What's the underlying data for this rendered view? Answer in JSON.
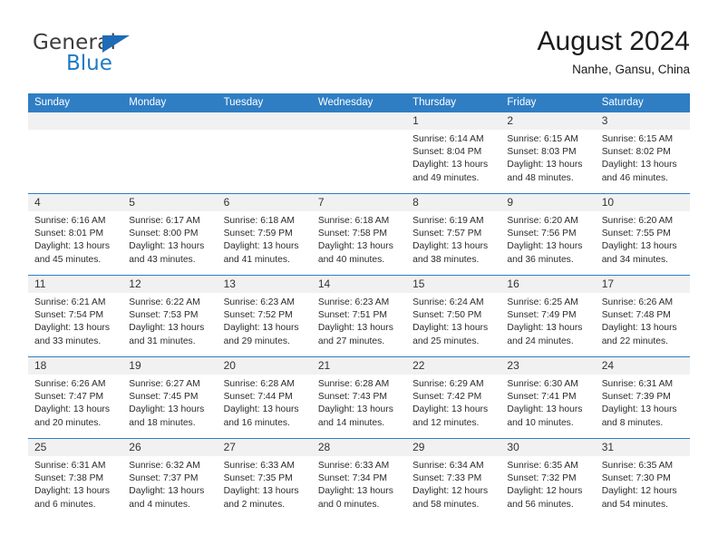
{
  "brand": {
    "name_part1": "General",
    "name_part2": "Blue",
    "flag_icon": "triangle-flag-icon"
  },
  "header": {
    "title": "August 2024",
    "subtitle": "Nanhe, Gansu, China"
  },
  "weekdays": [
    "Sunday",
    "Monday",
    "Tuesday",
    "Wednesday",
    "Thursday",
    "Friday",
    "Saturday"
  ],
  "colors": {
    "header_blue": "#2f7ec4",
    "brand_blue": "#1f7ac4",
    "day_strip_gray": "#f1f1f1",
    "text": "#2b2b2b"
  },
  "weeks": [
    [
      {
        "day": "",
        "lines": []
      },
      {
        "day": "",
        "lines": []
      },
      {
        "day": "",
        "lines": []
      },
      {
        "day": "",
        "lines": []
      },
      {
        "day": "1",
        "lines": [
          "Sunrise: 6:14 AM",
          "Sunset: 8:04 PM",
          "Daylight: 13 hours",
          "and 49 minutes."
        ]
      },
      {
        "day": "2",
        "lines": [
          "Sunrise: 6:15 AM",
          "Sunset: 8:03 PM",
          "Daylight: 13 hours",
          "and 48 minutes."
        ]
      },
      {
        "day": "3",
        "lines": [
          "Sunrise: 6:15 AM",
          "Sunset: 8:02 PM",
          "Daylight: 13 hours",
          "and 46 minutes."
        ]
      }
    ],
    [
      {
        "day": "4",
        "lines": [
          "Sunrise: 6:16 AM",
          "Sunset: 8:01 PM",
          "Daylight: 13 hours",
          "and 45 minutes."
        ]
      },
      {
        "day": "5",
        "lines": [
          "Sunrise: 6:17 AM",
          "Sunset: 8:00 PM",
          "Daylight: 13 hours",
          "and 43 minutes."
        ]
      },
      {
        "day": "6",
        "lines": [
          "Sunrise: 6:18 AM",
          "Sunset: 7:59 PM",
          "Daylight: 13 hours",
          "and 41 minutes."
        ]
      },
      {
        "day": "7",
        "lines": [
          "Sunrise: 6:18 AM",
          "Sunset: 7:58 PM",
          "Daylight: 13 hours",
          "and 40 minutes."
        ]
      },
      {
        "day": "8",
        "lines": [
          "Sunrise: 6:19 AM",
          "Sunset: 7:57 PM",
          "Daylight: 13 hours",
          "and 38 minutes."
        ]
      },
      {
        "day": "9",
        "lines": [
          "Sunrise: 6:20 AM",
          "Sunset: 7:56 PM",
          "Daylight: 13 hours",
          "and 36 minutes."
        ]
      },
      {
        "day": "10",
        "lines": [
          "Sunrise: 6:20 AM",
          "Sunset: 7:55 PM",
          "Daylight: 13 hours",
          "and 34 minutes."
        ]
      }
    ],
    [
      {
        "day": "11",
        "lines": [
          "Sunrise: 6:21 AM",
          "Sunset: 7:54 PM",
          "Daylight: 13 hours",
          "and 33 minutes."
        ]
      },
      {
        "day": "12",
        "lines": [
          "Sunrise: 6:22 AM",
          "Sunset: 7:53 PM",
          "Daylight: 13 hours",
          "and 31 minutes."
        ]
      },
      {
        "day": "13",
        "lines": [
          "Sunrise: 6:23 AM",
          "Sunset: 7:52 PM",
          "Daylight: 13 hours",
          "and 29 minutes."
        ]
      },
      {
        "day": "14",
        "lines": [
          "Sunrise: 6:23 AM",
          "Sunset: 7:51 PM",
          "Daylight: 13 hours",
          "and 27 minutes."
        ]
      },
      {
        "day": "15",
        "lines": [
          "Sunrise: 6:24 AM",
          "Sunset: 7:50 PM",
          "Daylight: 13 hours",
          "and 25 minutes."
        ]
      },
      {
        "day": "16",
        "lines": [
          "Sunrise: 6:25 AM",
          "Sunset: 7:49 PM",
          "Daylight: 13 hours",
          "and 24 minutes."
        ]
      },
      {
        "day": "17",
        "lines": [
          "Sunrise: 6:26 AM",
          "Sunset: 7:48 PM",
          "Daylight: 13 hours",
          "and 22 minutes."
        ]
      }
    ],
    [
      {
        "day": "18",
        "lines": [
          "Sunrise: 6:26 AM",
          "Sunset: 7:47 PM",
          "Daylight: 13 hours",
          "and 20 minutes."
        ]
      },
      {
        "day": "19",
        "lines": [
          "Sunrise: 6:27 AM",
          "Sunset: 7:45 PM",
          "Daylight: 13 hours",
          "and 18 minutes."
        ]
      },
      {
        "day": "20",
        "lines": [
          "Sunrise: 6:28 AM",
          "Sunset: 7:44 PM",
          "Daylight: 13 hours",
          "and 16 minutes."
        ]
      },
      {
        "day": "21",
        "lines": [
          "Sunrise: 6:28 AM",
          "Sunset: 7:43 PM",
          "Daylight: 13 hours",
          "and 14 minutes."
        ]
      },
      {
        "day": "22",
        "lines": [
          "Sunrise: 6:29 AM",
          "Sunset: 7:42 PM",
          "Daylight: 13 hours",
          "and 12 minutes."
        ]
      },
      {
        "day": "23",
        "lines": [
          "Sunrise: 6:30 AM",
          "Sunset: 7:41 PM",
          "Daylight: 13 hours",
          "and 10 minutes."
        ]
      },
      {
        "day": "24",
        "lines": [
          "Sunrise: 6:31 AM",
          "Sunset: 7:39 PM",
          "Daylight: 13 hours",
          "and 8 minutes."
        ]
      }
    ],
    [
      {
        "day": "25",
        "lines": [
          "Sunrise: 6:31 AM",
          "Sunset: 7:38 PM",
          "Daylight: 13 hours",
          "and 6 minutes."
        ]
      },
      {
        "day": "26",
        "lines": [
          "Sunrise: 6:32 AM",
          "Sunset: 7:37 PM",
          "Daylight: 13 hours",
          "and 4 minutes."
        ]
      },
      {
        "day": "27",
        "lines": [
          "Sunrise: 6:33 AM",
          "Sunset: 7:35 PM",
          "Daylight: 13 hours",
          "and 2 minutes."
        ]
      },
      {
        "day": "28",
        "lines": [
          "Sunrise: 6:33 AM",
          "Sunset: 7:34 PM",
          "Daylight: 13 hours",
          "and 0 minutes."
        ]
      },
      {
        "day": "29",
        "lines": [
          "Sunrise: 6:34 AM",
          "Sunset: 7:33 PM",
          "Daylight: 12 hours",
          "and 58 minutes."
        ]
      },
      {
        "day": "30",
        "lines": [
          "Sunrise: 6:35 AM",
          "Sunset: 7:32 PM",
          "Daylight: 12 hours",
          "and 56 minutes."
        ]
      },
      {
        "day": "31",
        "lines": [
          "Sunrise: 6:35 AM",
          "Sunset: 7:30 PM",
          "Daylight: 12 hours",
          "and 54 minutes."
        ]
      }
    ]
  ]
}
